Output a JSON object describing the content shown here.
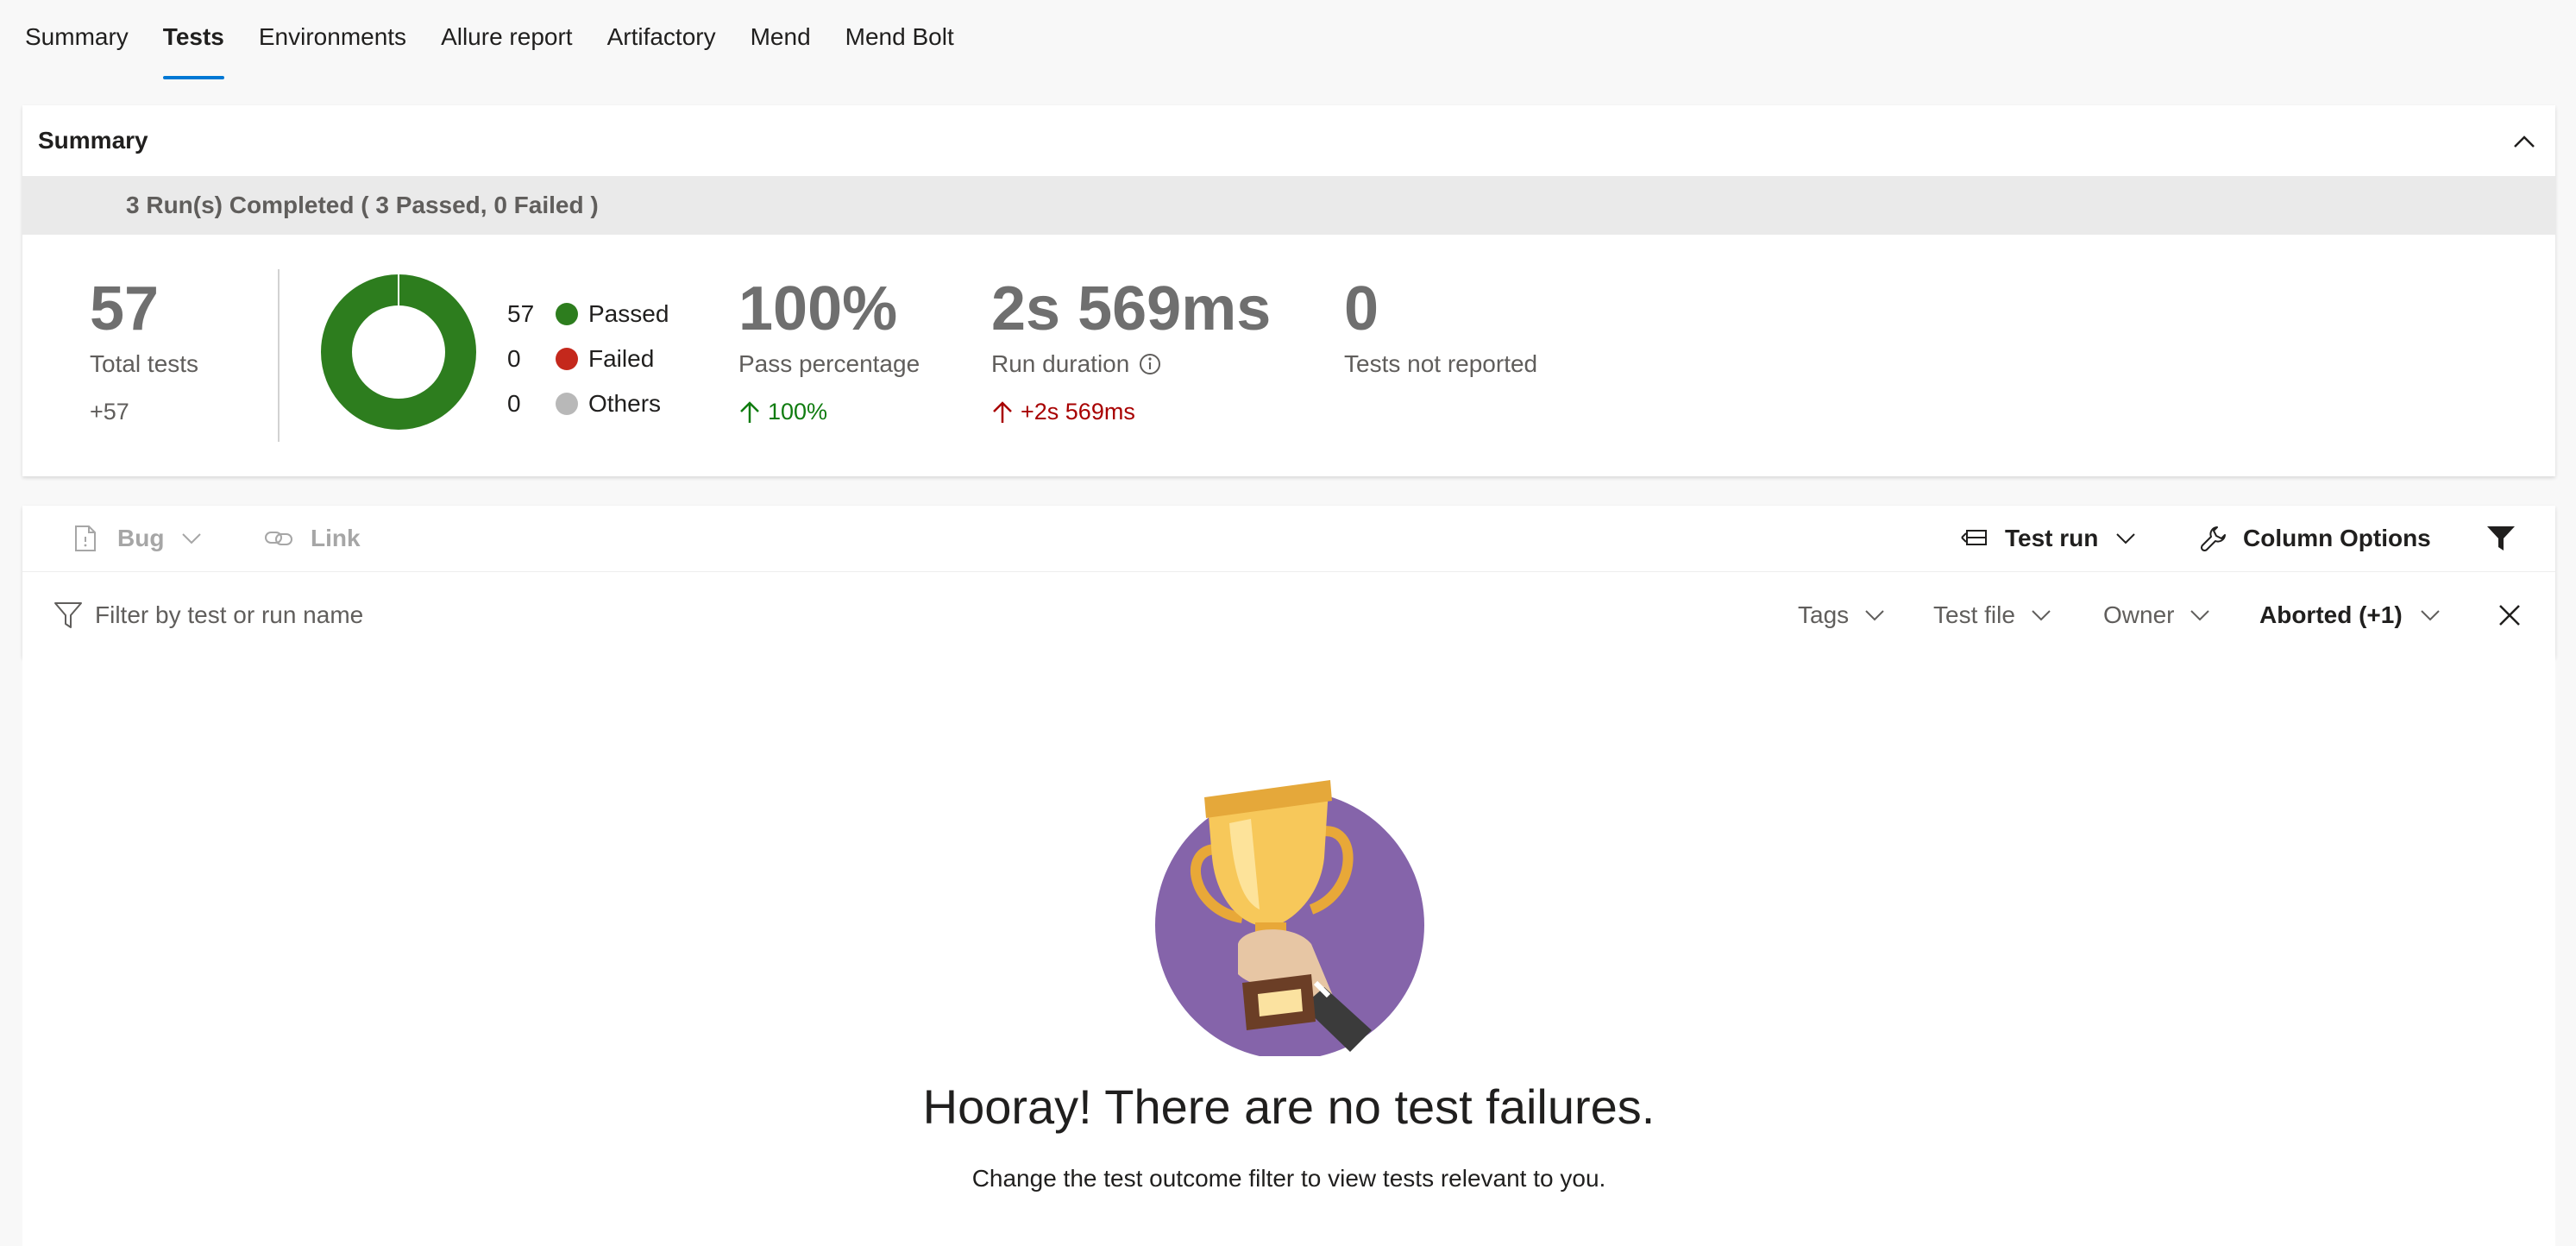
{
  "tabs": [
    {
      "label": "Summary"
    },
    {
      "label": "Tests"
    },
    {
      "label": "Environments"
    },
    {
      "label": "Allure report"
    },
    {
      "label": "Artifactory"
    },
    {
      "label": "Mend"
    },
    {
      "label": "Mend Bolt"
    }
  ],
  "active_tab": "Tests",
  "summary": {
    "title": "Summary",
    "runs_banner": "3 Run(s) Completed ( 3 Passed, 0 Failed )",
    "total_tests": "57",
    "total_tests_label": "Total tests",
    "total_tests_delta": "+57",
    "outcomes": [
      {
        "count": "57",
        "label": "Passed",
        "color": "#2d7d1e"
      },
      {
        "count": "0",
        "label": "Failed",
        "color": "#c4281c"
      },
      {
        "count": "0",
        "label": "Others",
        "color": "#b8b8b8"
      }
    ],
    "pass_percentage": "100%",
    "pass_percentage_label": "Pass percentage",
    "pass_percentage_delta": "100%",
    "run_duration": "2s 569ms",
    "run_duration_label": "Run duration",
    "run_duration_delta": "+2s 569ms",
    "not_reported": "0",
    "not_reported_label": "Tests not reported"
  },
  "toolbar": {
    "bug_label": "Bug",
    "link_label": "Link",
    "test_run_label": "Test run",
    "column_options_label": "Column Options"
  },
  "filter": {
    "placeholder": "Filter by test or run name",
    "tags_label": "Tags",
    "test_file_label": "Test file",
    "owner_label": "Owner",
    "outcome_label": "Aborted (+1)"
  },
  "empty_state": {
    "title": "Hooray! There are no test failures.",
    "hint": "Change the test outcome filter to view tests relevant to you."
  },
  "colors": {
    "accent": "#0078d4",
    "positive": "#107c10",
    "negative": "#a80000"
  }
}
